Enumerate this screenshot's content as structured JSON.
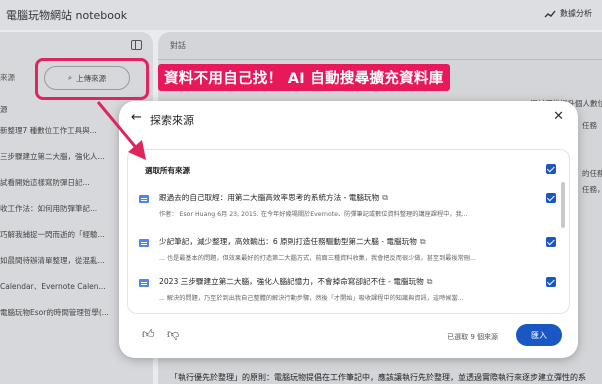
{
  "header": {
    "app_title": "電腦玩物網站 notebook",
    "analysis_label": "數據分析"
  },
  "left_panel": {
    "source_label": "來源",
    "add_button_label": "上傳來源",
    "section_label": "源",
    "items": [
      "新整理7 種數位工作工具與...",
      "三步驟建立第二大腦，強化人...",
      "試看開始這樣寫防彈日記...",
      "收工作法：如何用防彈筆記...",
      "巧解我捕捉一閃而逝的「經驗...",
      "如晨間待辦清單整理，從混亂...",
      "Calendar、Evernote Calen...",
      "電腦玩物Esor的時間管理哲學(..."
    ]
  },
  "chat_panel": {
    "title": "對話",
    "bg_snippets": [
      "探討哪些提升個人數位",
      "任務",
      "的任務",
      "任務，",
      "「執行優先於整理」的原則：電腦玩物提倡在工作筆記中，應該讓執行先於整理，並透過實際執行來逐步建立彈性的系"
    ]
  },
  "annotation": {
    "callout_text": "資料不用自己找！ AI 自動搜尋擴充資料庫"
  },
  "modal": {
    "title": "探索來源",
    "select_all_label": "選取所有來源",
    "sources": [
      {
        "title": "跟過去的自己取經：用第二大腦高效率思考的系統方法 - 電腦玩物",
        "snippet": "作者： Esor Huang 6月 23, 2015. 在今年好幾場關於Evernote、防彈筆記或數位資料整理的講座課程中，我..."
      },
      {
        "title": "少記筆記，減少整理，高效輸出：6 原則打造任務驅動型第二大腦 - 電腦玩物",
        "snippet": "... 也是最基本的問題，但效果最好的打造第二大腦方式，前面三種資料收集，我會把反而很少做，甚至到最後常刪..."
      },
      {
        "title": "2023 三步驟建立第二大腦，強化人腦記憶力，不會掉命寫卻記不住 - 電腦玩物",
        "snippet": "... 解決的問題，乃至於到出我自己整體的解決行動步驟，然後「才開始」吸收課程中的知識與資訊，這時候當..."
      }
    ],
    "selected_count_label": "已選取 9 個來源",
    "import_label": "匯入"
  },
  "colors": {
    "accent_blue": "#1a56c4",
    "annotation_pink": "#e8195a"
  }
}
